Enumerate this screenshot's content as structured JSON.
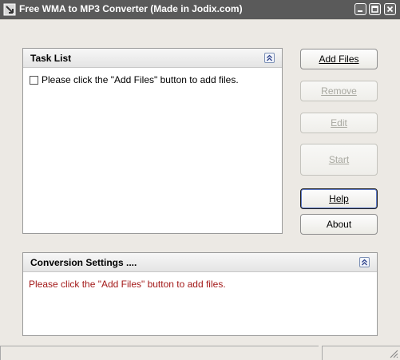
{
  "window": {
    "title": "Free WMA to MP3 Converter   (Made in Jodix.com)",
    "controls": [
      "minimize",
      "maximize",
      "close"
    ]
  },
  "task_list": {
    "title": "Task List",
    "placeholder_item": "Please click the \"Add Files\" button to add files.",
    "placeholder_checked": false
  },
  "buttons": {
    "add_files": "Add Files",
    "remove": "Remove",
    "edit": "Edit",
    "start": "Start",
    "help": "Help",
    "about": "About"
  },
  "conversion_settings": {
    "title": "Conversion Settings ....",
    "message": "Please click the \"Add Files\" button to add files."
  },
  "colors": {
    "titlebar": "#5a5a5a",
    "message_text": "#a31919",
    "disabled_text": "#a8a8a0"
  }
}
